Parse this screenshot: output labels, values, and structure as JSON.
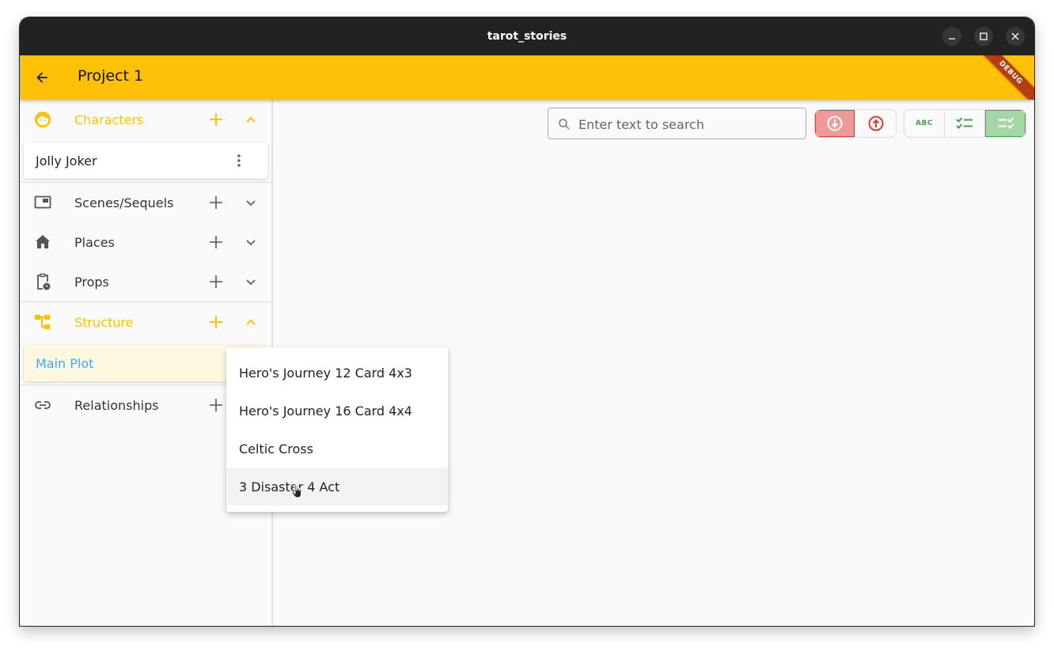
{
  "window": {
    "title": "tarot_stories",
    "controls": [
      "minimize",
      "maximize",
      "close"
    ]
  },
  "appbar": {
    "back_icon": "arrow-back-icon",
    "title": "Project 1",
    "debug_banner": "DEBUG"
  },
  "colors": {
    "accent": "#ffc107",
    "selected_text": "#42a5f5",
    "selected_bg": "#fff8e1",
    "red_toggle": "#ef9a9a",
    "green_toggle": "#a5d6a7"
  },
  "sidebar": {
    "sections": [
      {
        "label": "Characters",
        "icon": "face-icon",
        "expanded": true,
        "items": [
          "Jolly Joker"
        ]
      },
      {
        "label": "Scenes/Sequels",
        "icon": "scene-icon",
        "expanded": false
      },
      {
        "label": "Places",
        "icon": "home-icon",
        "expanded": false
      },
      {
        "label": "Props",
        "icon": "clipboard-clock-icon",
        "expanded": false
      },
      {
        "label": "Structure",
        "icon": "structure-icon",
        "expanded": true,
        "items": [
          "Main Plot"
        ]
      },
      {
        "label": "Relationships",
        "icon": "link-icon",
        "expanded": false
      }
    ]
  },
  "toolbar": {
    "search_placeholder": "Enter text to search",
    "search_value": "",
    "sort_buttons": [
      {
        "icon": "arrow-circle-down-icon",
        "selected": true
      },
      {
        "icon": "arrow-circle-up-icon",
        "selected": false
      }
    ],
    "view_buttons": [
      {
        "icon": "abc-icon",
        "label": "ABC",
        "selected": false
      },
      {
        "icon": "checklist-icon",
        "selected": false
      },
      {
        "icon": "checklist-rtl-icon",
        "selected": true
      }
    ]
  },
  "popup_menu": {
    "items": [
      {
        "label": "Hero's Journey 12 Card 4x3"
      },
      {
        "label": "Hero's Journey 16 Card 4x4"
      },
      {
        "label": "Celtic Cross"
      },
      {
        "label": "3 Disaster 4 Act",
        "hovered": true
      }
    ]
  }
}
